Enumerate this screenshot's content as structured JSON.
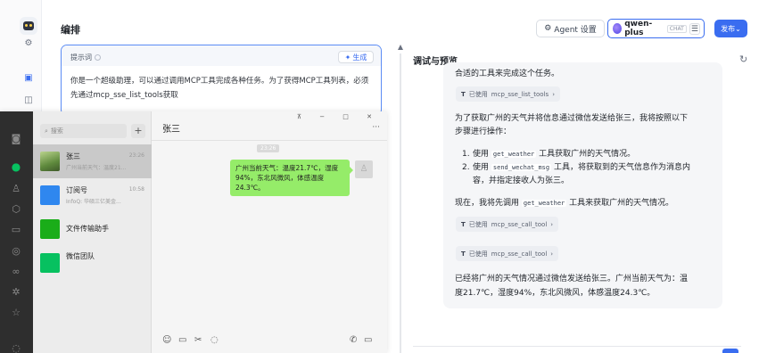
{
  "header": {
    "title": "编排",
    "agent_settings_label": "Agent 设置",
    "model_name": "qwen-plus",
    "model_tag": "CHAT",
    "publish_label": "发布"
  },
  "rail": {
    "icons": [
      "bot-avatar",
      "settings-icon",
      "app-icon",
      "layout-icon"
    ]
  },
  "prompt": {
    "label": "提示词",
    "generate_label": "生成",
    "text": "你是一个超级助理，可以通过调用MCP工具完成各种任务。为了获得MCP工具列表，必须先通过mcp_sse_list_tools获取"
  },
  "debug": {
    "title": "调试与预览",
    "line_top": "合适的工具来完成这个任务。",
    "chip1": {
      "prefix": "已使用",
      "tool": "mcp_sse_list_tools"
    },
    "plan_intro_1": "为了获取广州的天气并将信息通过微信发送给张三，我将按照以下",
    "plan_intro_2": "步骤进行操作：",
    "step1_num": "1.",
    "step1_a": "使用",
    "step1_code": "get_weather",
    "step1_b": "工具获取广州的天气情况。",
    "step2_num": "2.",
    "step2_a": "使用",
    "step2_code": "send_wechat_msg",
    "step2_b": "工具，将获取到的天气信息作为消息内",
    "step2_c": "容，并指定接收人为张三。",
    "now_a": "现在，我将先调用",
    "now_code": "get_weather",
    "now_b": "工具来获取广州的天气情况。",
    "chip2": {
      "prefix": "已使用",
      "tool": "mcp_sse_call_tool"
    },
    "chip3": {
      "prefix": "已使用",
      "tool": "mcp_sse_call_tool"
    },
    "final_1": "已经将广州的天气情况通过微信发送给张三。广州当前天气为：温",
    "final_2": "度21.7℃，湿度94%，东北风微风，体感温度24.3℃。"
  },
  "wechat": {
    "search_placeholder": "搜索",
    "chats": [
      {
        "name": "张三",
        "time": "23:26",
        "preview": "广州当前天气：温度21...",
        "color": "#7fa05c"
      },
      {
        "name": "订阅号",
        "time": "10:58",
        "preview": "InfoQ: 华硕三亿美金...",
        "color": "#2f87ef"
      },
      {
        "name": "文件传输助手",
        "time": "",
        "preview": "",
        "color": "#1aad19"
      },
      {
        "name": "微信团队",
        "time": "",
        "preview": "",
        "color": "#07c160"
      }
    ],
    "chat_title": "张三",
    "timestamp": "23:26",
    "message": "广州当前天气：温度21.7℃，湿度94%，东北风微风，体感温度24.3℃。"
  }
}
